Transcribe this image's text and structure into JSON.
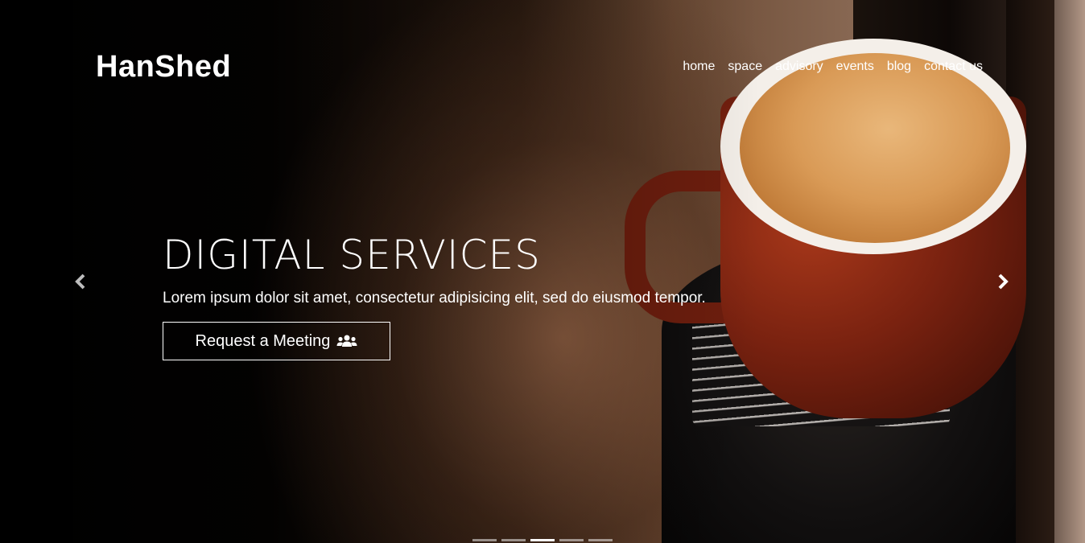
{
  "brand": {
    "name": "HanShed"
  },
  "nav": {
    "items": [
      {
        "label": "home"
      },
      {
        "label": "space"
      },
      {
        "label": "advisory"
      },
      {
        "label": "events"
      },
      {
        "label": "blog"
      },
      {
        "label": "contact us"
      }
    ]
  },
  "hero": {
    "title": "DIGITAL SERVICES",
    "subtitle": "Lorem ipsum dolor sit amet, consectetur adipisicing elit, sed do eiusmod tempor.",
    "cta_label": "Request a Meeting",
    "cta_icon": "users-icon"
  },
  "carousel": {
    "prev_icon": "chevron-left-icon",
    "next_icon": "chevron-right-icon",
    "slide_count": 5,
    "active_index": 2
  },
  "colors": {
    "text": "#ffffff",
    "indicator_inactive": "rgba(255,255,255,0.5)"
  }
}
